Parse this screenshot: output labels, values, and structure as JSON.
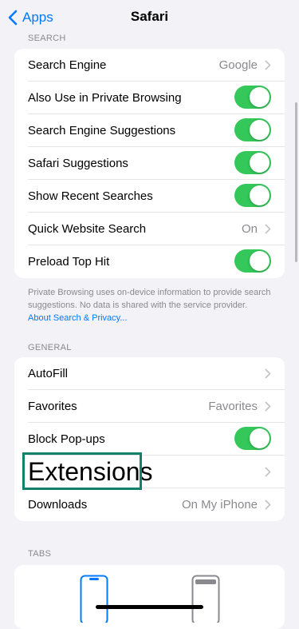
{
  "nav": {
    "back_label": "Apps",
    "title": "Safari"
  },
  "search_section": {
    "header": "SEARCH",
    "rows": [
      {
        "label": "Search Engine",
        "value": "Google",
        "type": "chevron"
      },
      {
        "label": "Also Use in Private Browsing",
        "type": "toggle",
        "on": true
      },
      {
        "label": "Search Engine Suggestions",
        "type": "toggle",
        "on": true
      },
      {
        "label": "Safari Suggestions",
        "type": "toggle",
        "on": true
      },
      {
        "label": "Show Recent Searches",
        "type": "toggle",
        "on": true
      },
      {
        "label": "Quick Website Search",
        "value": "On",
        "type": "chevron"
      },
      {
        "label": "Preload Top Hit",
        "type": "toggle",
        "on": true
      }
    ],
    "footnote": "Private Browsing uses on-device information to provide search suggestions. No data is shared with the service provider.",
    "footnote_link": "About Search & Privacy..."
  },
  "general_section": {
    "header": "GENERAL",
    "rows": [
      {
        "label": "AutoFill",
        "type": "chevron"
      },
      {
        "label": "Favorites",
        "value": "Favorites",
        "type": "chevron"
      },
      {
        "label": "Block Pop-ups",
        "type": "toggle",
        "on": true
      },
      {
        "label": "Extensions",
        "type": "chevron",
        "highlighted": true
      },
      {
        "label": "Downloads",
        "value": "On My iPhone",
        "type": "chevron"
      }
    ]
  },
  "tabs_section": {
    "header": "TABS"
  },
  "colors": {
    "accent": "#007aff",
    "toggle_on": "#34c759",
    "highlight_border": "#13806a"
  }
}
